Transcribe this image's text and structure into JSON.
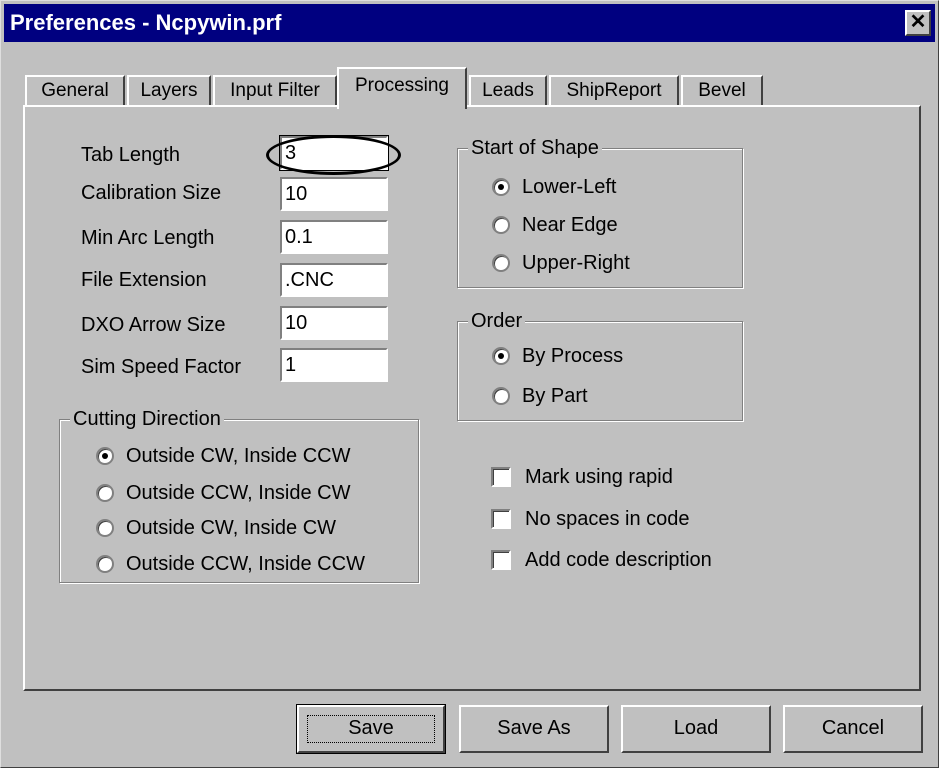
{
  "window": {
    "title": "Preferences - Ncpywin.prf",
    "close_glyph": "✕"
  },
  "tabs": [
    {
      "label": "General",
      "active": false
    },
    {
      "label": "Layers",
      "active": false
    },
    {
      "label": "Input Filter",
      "active": false
    },
    {
      "label": "Processing",
      "active": true
    },
    {
      "label": "Leads",
      "active": false
    },
    {
      "label": "ShipReport",
      "active": false
    },
    {
      "label": "Bevel",
      "active": false
    }
  ],
  "fields": [
    {
      "label": "Tab Length",
      "value": "3"
    },
    {
      "label": "Calibration Size",
      "value": "10"
    },
    {
      "label": "Min Arc Length",
      "value": "0.1"
    },
    {
      "label": "File Extension",
      "value": ".CNC"
    },
    {
      "label": "DXO Arrow Size",
      "value": "10"
    },
    {
      "label": "Sim Speed Factor",
      "value": "1"
    }
  ],
  "cutting_direction": {
    "title": "Cutting Direction",
    "options": [
      {
        "label": "Outside CW, Inside CCW",
        "checked": true
      },
      {
        "label": "Outside CCW, Inside CW",
        "checked": false
      },
      {
        "label": "Outside CW, Inside CW",
        "checked": false
      },
      {
        "label": "Outside CCW, Inside CCW",
        "checked": false
      }
    ]
  },
  "start_of_shape": {
    "title": "Start of Shape",
    "options": [
      {
        "label": "Lower-Left",
        "checked": true
      },
      {
        "label": "Near Edge",
        "checked": false
      },
      {
        "label": "Upper-Right",
        "checked": false
      }
    ]
  },
  "order": {
    "title": "Order",
    "options": [
      {
        "label": "By Process",
        "checked": true
      },
      {
        "label": "By Part",
        "checked": false
      }
    ]
  },
  "checkboxes": [
    {
      "label": "Mark using rapid",
      "checked": false
    },
    {
      "label": "No spaces in code",
      "checked": false
    },
    {
      "label": "Add code description",
      "checked": false
    }
  ],
  "buttons": {
    "save": "Save",
    "save_as": "Save As",
    "load": "Load",
    "cancel": "Cancel"
  }
}
